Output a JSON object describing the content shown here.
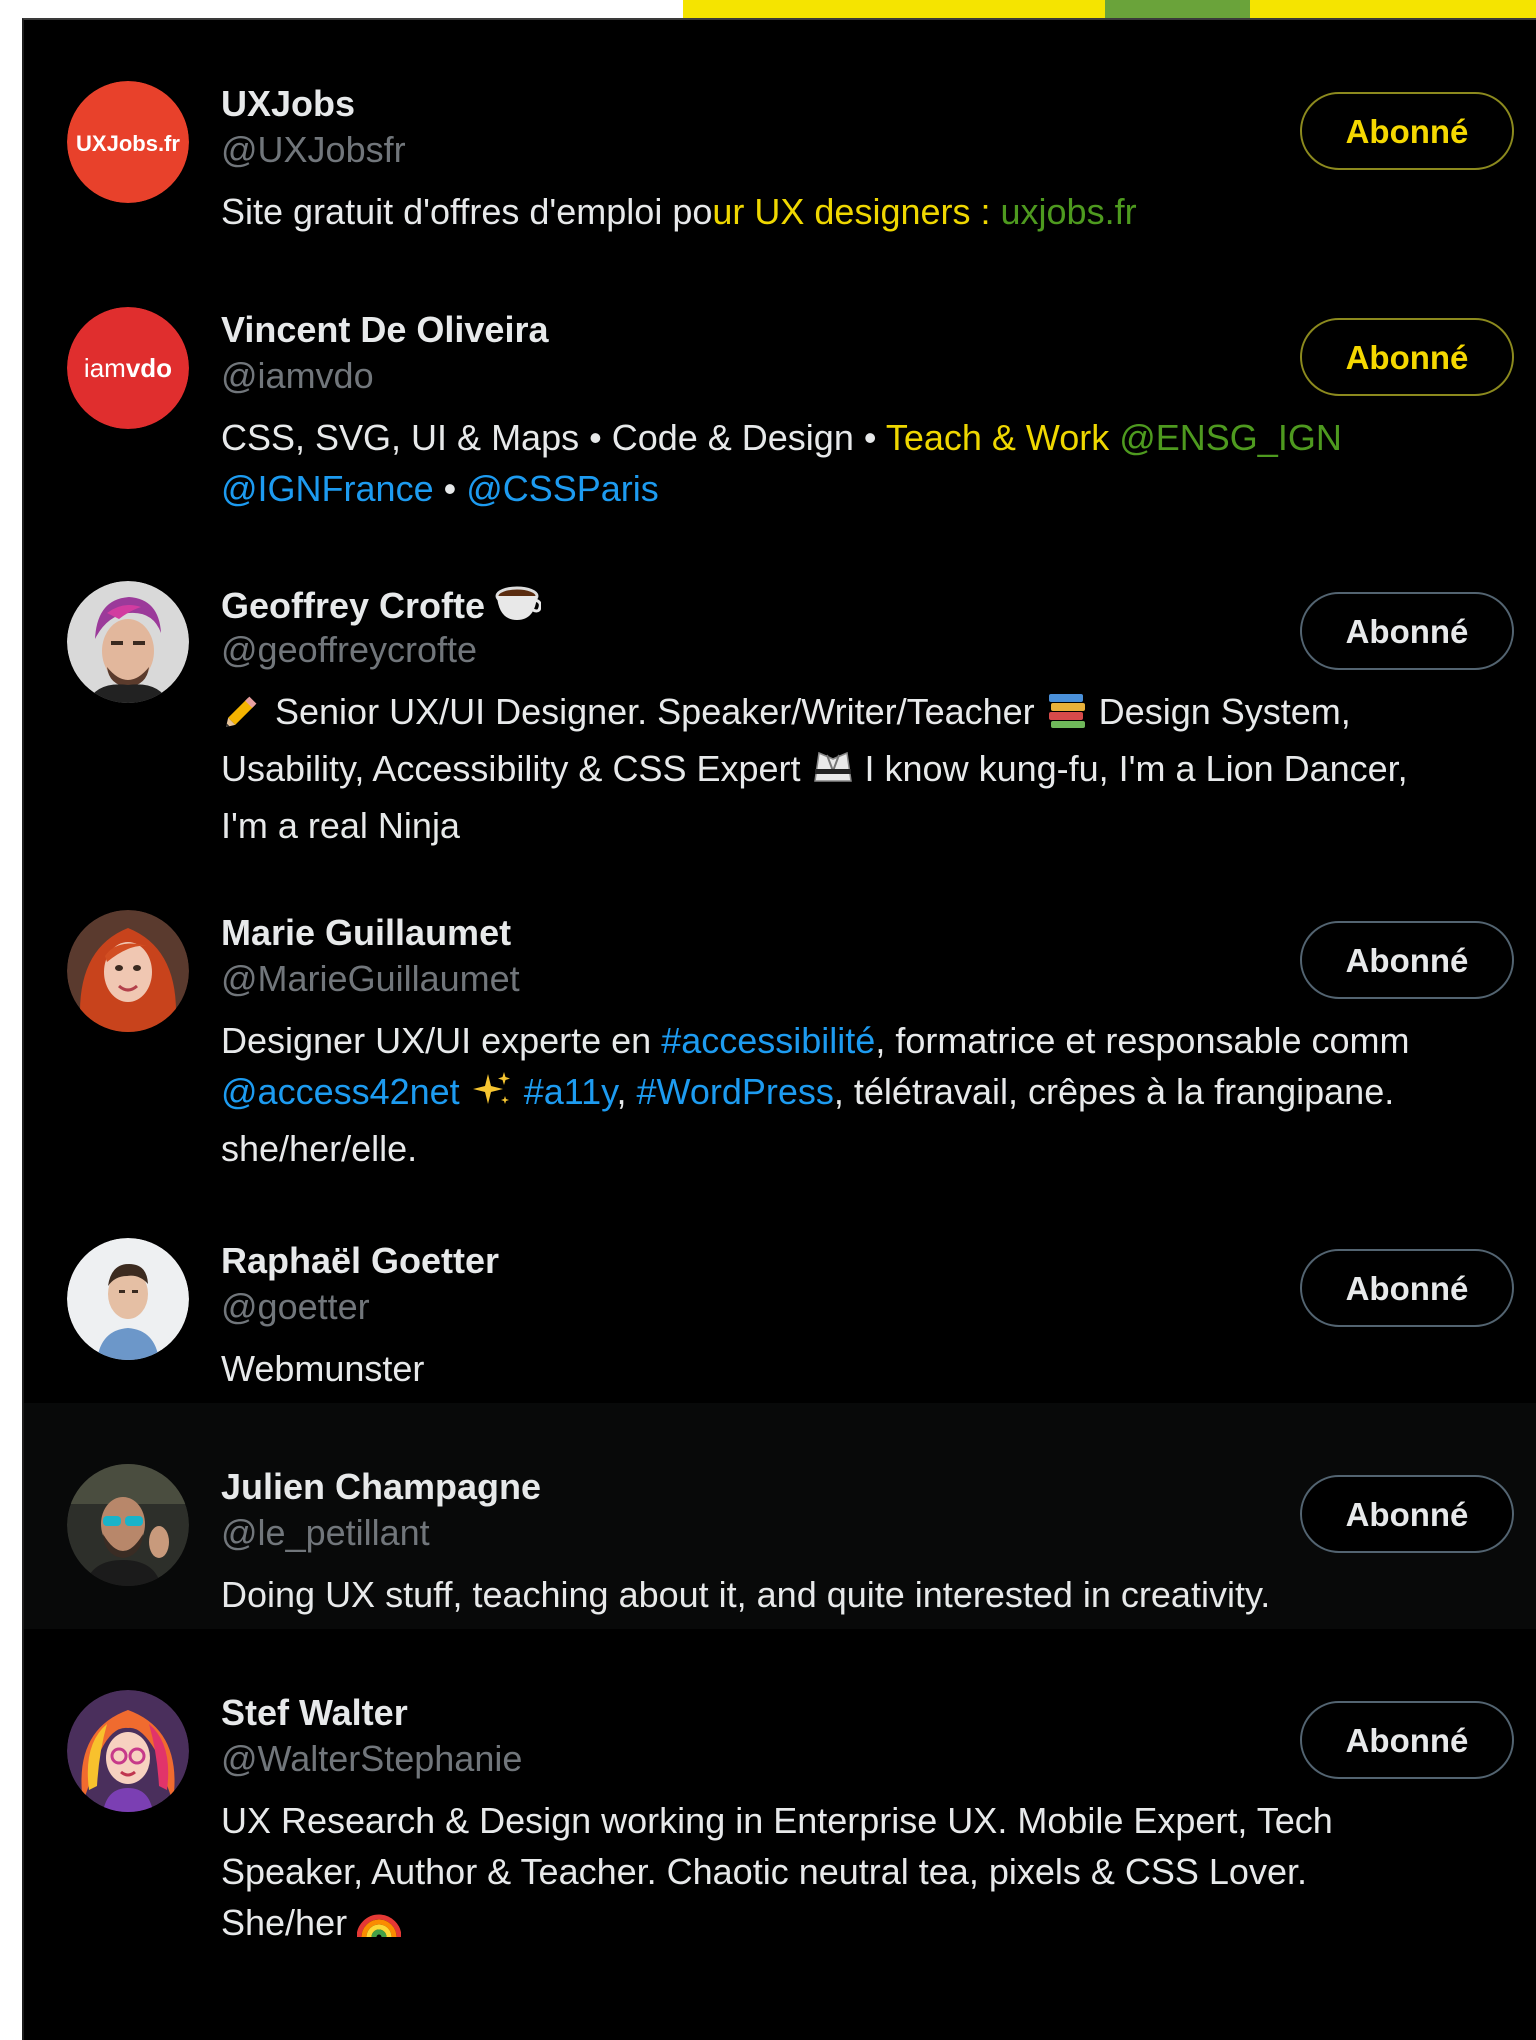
{
  "accounts": [
    {
      "name": "UXJobs",
      "handle": "@UXJobsfr",
      "follow_label": "Abonné",
      "avatar_text": "UXJobs.fr",
      "bio": [
        {
          "t": "Site gratuit d'offres d'emploi po",
          "c": ""
        },
        {
          "t": "ur UX designers : ",
          "c": "yel"
        },
        {
          "t": "uxjobs.fr",
          "c": "grn"
        }
      ]
    },
    {
      "name": "Vincent De Oliveira",
      "handle": "@iamvdo",
      "follow_label": "Abonné",
      "avatar_text_a": "iam",
      "avatar_text_b": "vdo",
      "bio": [
        {
          "t": "CSS, SVG, UI & Maps • Code & Design • ",
          "c": ""
        },
        {
          "t": "Teach & Work ",
          "c": "yel"
        },
        {
          "t": "@ENSG_IGN",
          "c": "grn"
        },
        {
          "t": "\n",
          "c": ""
        },
        {
          "t": "@IGNFrance",
          "c": "link"
        },
        {
          "t": " • ",
          "c": ""
        },
        {
          "t": "@CSSParis",
          "c": "link"
        }
      ]
    },
    {
      "name": "Geoffrey Crofte",
      "handle": "@geoffreycrofte",
      "follow_label": "Abonné",
      "bio": [
        {
          "t": "pencil",
          "c": "emoji"
        },
        {
          "t": " Senior UX/UI Designer. Speaker/Writer/Teacher ",
          "c": ""
        },
        {
          "t": "books",
          "c": "emoji"
        },
        {
          "t": " Design System,",
          "c": ""
        },
        {
          "t": "\n",
          "c": ""
        },
        {
          "t": "Usability, Accessibility & CSS Expert ",
          "c": ""
        },
        {
          "t": "gi",
          "c": "emoji"
        },
        {
          "t": " I know kung-fu, I'm a Lion Dancer,",
          "c": ""
        },
        {
          "t": "\n",
          "c": ""
        },
        {
          "t": "I'm a real Ninja",
          "c": ""
        }
      ]
    },
    {
      "name": "Marie Guillaumet",
      "handle": "@MarieGuillaumet",
      "follow_label": "Abonné",
      "bio": [
        {
          "t": "Designer UX/UI experte en ",
          "c": ""
        },
        {
          "t": "#accessibilité",
          "c": "link"
        },
        {
          "t": ", formatrice et responsable comm",
          "c": ""
        },
        {
          "t": "\n",
          "c": ""
        },
        {
          "t": "@access42net",
          "c": "link"
        },
        {
          "t": " ",
          "c": ""
        },
        {
          "t": "sparkles",
          "c": "emoji"
        },
        {
          "t": " ",
          "c": ""
        },
        {
          "t": "#a11y",
          "c": "link"
        },
        {
          "t": ", ",
          "c": ""
        },
        {
          "t": "#WordPress",
          "c": "link"
        },
        {
          "t": ", télétravail, crêpes à la frangipane.",
          "c": ""
        },
        {
          "t": "\n",
          "c": ""
        },
        {
          "t": "she/her/elle.",
          "c": ""
        }
      ]
    },
    {
      "name": "Raphaël Goetter",
      "handle": "@goetter",
      "follow_label": "Abonné",
      "bio": [
        {
          "t": "Webmunster",
          "c": ""
        }
      ]
    },
    {
      "name": "Julien Champagne",
      "handle": "@le_petillant",
      "follow_label": "Abonné",
      "bio": [
        {
          "t": "Doing UX stuff, teaching about it, and quite interested in creativity.",
          "c": ""
        }
      ]
    },
    {
      "name": "Stef Walter",
      "handle": "@WalterStephanie",
      "follow_label": "Abonné",
      "bio": [
        {
          "t": "UX Research & Design working in Enterprise UX. Mobile Expert, Tech",
          "c": ""
        },
        {
          "t": "\n",
          "c": ""
        },
        {
          "t": "Speaker, Author & Teacher. Chaotic neutral tea, pixels & CSS Lover.",
          "c": ""
        },
        {
          "t": "\n",
          "c": ""
        },
        {
          "t": "She/her ",
          "c": ""
        },
        {
          "t": "rainbow",
          "c": "emoji"
        }
      ]
    }
  ],
  "emoji_names": {
    "coffee": "coffee-icon",
    "pencil": "pencil-icon",
    "books": "books-icon",
    "gi": "martial-arts-uniform-icon",
    "sparkles": "sparkles-icon",
    "rainbow": "rainbow-icon"
  }
}
